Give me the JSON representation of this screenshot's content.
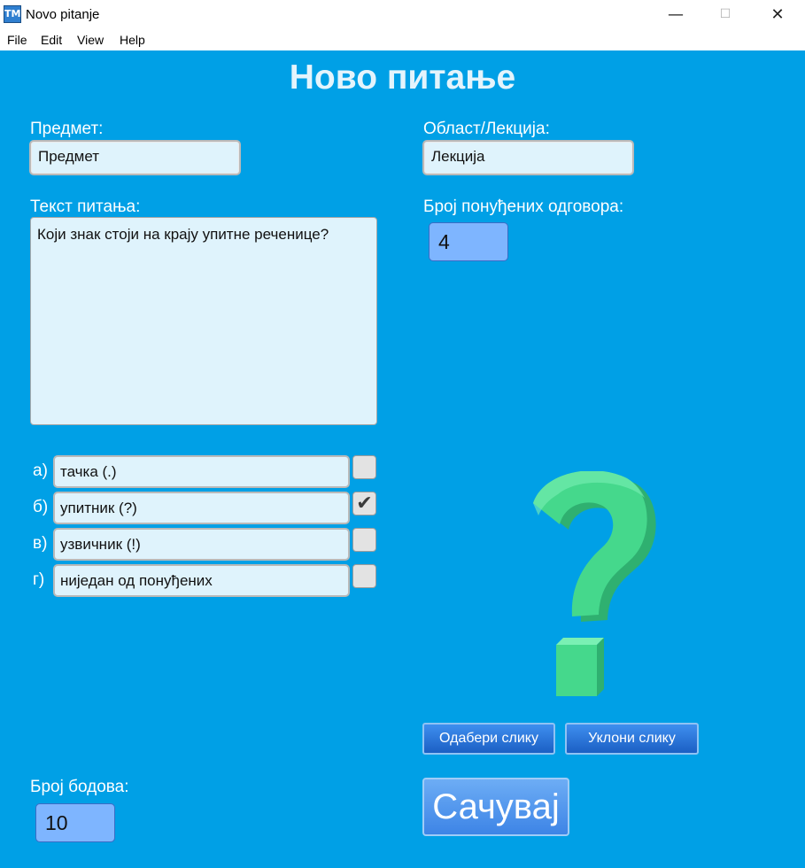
{
  "window": {
    "title": "Novo pitanje",
    "icon_text": "TM",
    "minimize": "—",
    "maximize": "☐",
    "close": "✕"
  },
  "menu": [
    "File",
    "Edit",
    "View",
    "Help"
  ],
  "form": {
    "heading": "Ново питање",
    "subject_label": "Предмет:",
    "subject_value": "Предмет",
    "area_label": "Област/Лекција:",
    "area_value": "Лекција",
    "question_label": "Текст питања:",
    "question_text": "Који знак стоји на крају упитне реченице?",
    "answers_count_label": "Број понуђених одговора:",
    "answers_count": "4",
    "answers": [
      {
        "letter": "а)",
        "text": "тачка (.)",
        "correct": false
      },
      {
        "letter": "б)",
        "text": "упитник (?)",
        "correct": true
      },
      {
        "letter": "в)",
        "text": "узвичник (!)",
        "correct": false
      },
      {
        "letter": "г)",
        "text": "ниједан од понуђених",
        "correct": false
      }
    ],
    "points_label": "Број бодова:",
    "points": "10",
    "choose_image_button": "Одабери слику",
    "remove_image_button": "Уклони слику",
    "save_button": "Сачувај"
  },
  "colors": {
    "background": "#00a0e6",
    "field": "#dff3fc",
    "spinbox": "#7eb5ff",
    "button": "#2a74db",
    "question_mark": "#45d88c"
  },
  "icons": {
    "check": "✔",
    "image": "question-mark-3d"
  }
}
